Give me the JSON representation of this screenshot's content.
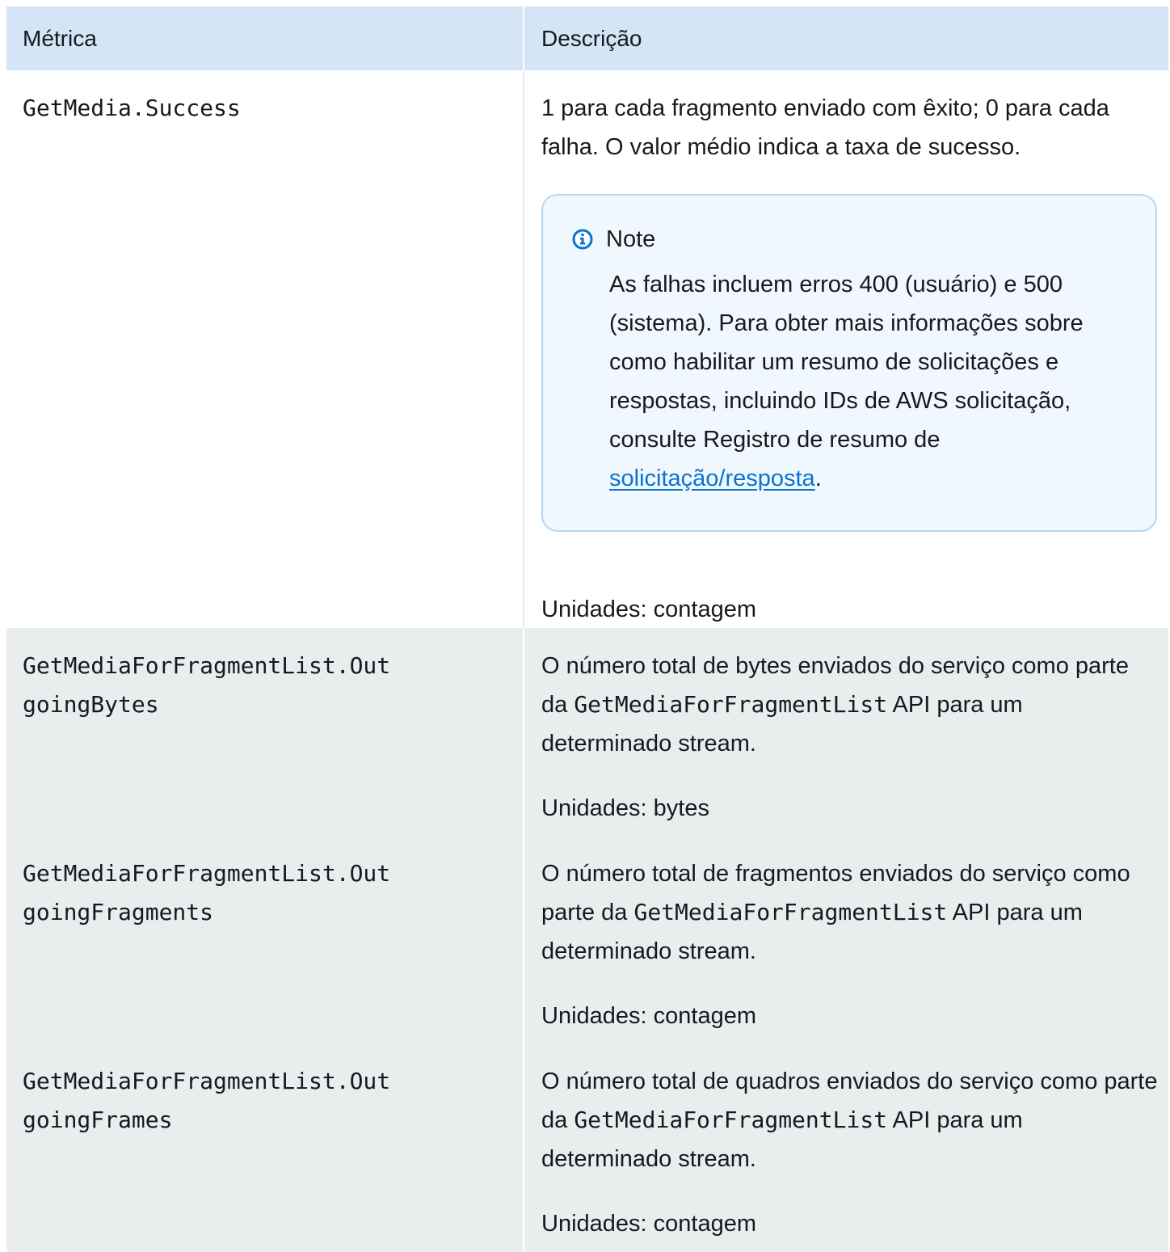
{
  "header": {
    "col_metric": "Métrica",
    "col_description": "Descrição"
  },
  "rows": [
    {
      "metric": "GetMedia.Success",
      "description": "1 para cada fragmento enviado com êxito; 0 para cada falha. O valor médio indica a taxa de sucesso.",
      "note": {
        "title": "Note",
        "icon": "info-circle-icon",
        "body": "As falhas incluem erros 400 (usuário) e 500 (sistema). Para obter mais informações sobre como habilitar um resumo de solicitações e respostas, incluindo IDs de AWS solicitação, consulte Registro de resumo de ",
        "link": "solicitação/resposta",
        "trailing": "."
      },
      "units": "Unidades: contagem"
    },
    {
      "metric_line1": "GetMediaForFragmentList.Out",
      "metric_line2": "goingBytes",
      "desc_prefix": "O número total de bytes enviados do serviço como parte da ",
      "desc_code": "GetMediaForFragmentList",
      "desc_suffix": " API para um determinado stream.",
      "units": "Unidades: bytes"
    },
    {
      "metric_line1": "GetMediaForFragmentList.Out",
      "metric_line2": "goingFragments",
      "desc_prefix": "O número total de fragmentos enviados do serviço como parte da ",
      "desc_code": "GetMediaForFragmentList",
      "desc_suffix": " API para um determinado stream.",
      "units": "Unidades: contagem"
    },
    {
      "metric_line1": "GetMediaForFragmentList.Out",
      "metric_line2": "goingFrames",
      "desc_prefix": "O número total de quadros enviados do serviço como parte da ",
      "desc_code": "GetMediaForFragmentList",
      "desc_suffix": " API para um determinado stream.",
      "units": "Unidades: contagem"
    }
  ],
  "colors": {
    "header_bg": "#d4e5f5",
    "row_alt_bg": "#eaeded",
    "note_bg": "#f1f8fd",
    "note_border": "#b3d7f5",
    "link": "#0972d3",
    "icon": "#0972d3"
  }
}
